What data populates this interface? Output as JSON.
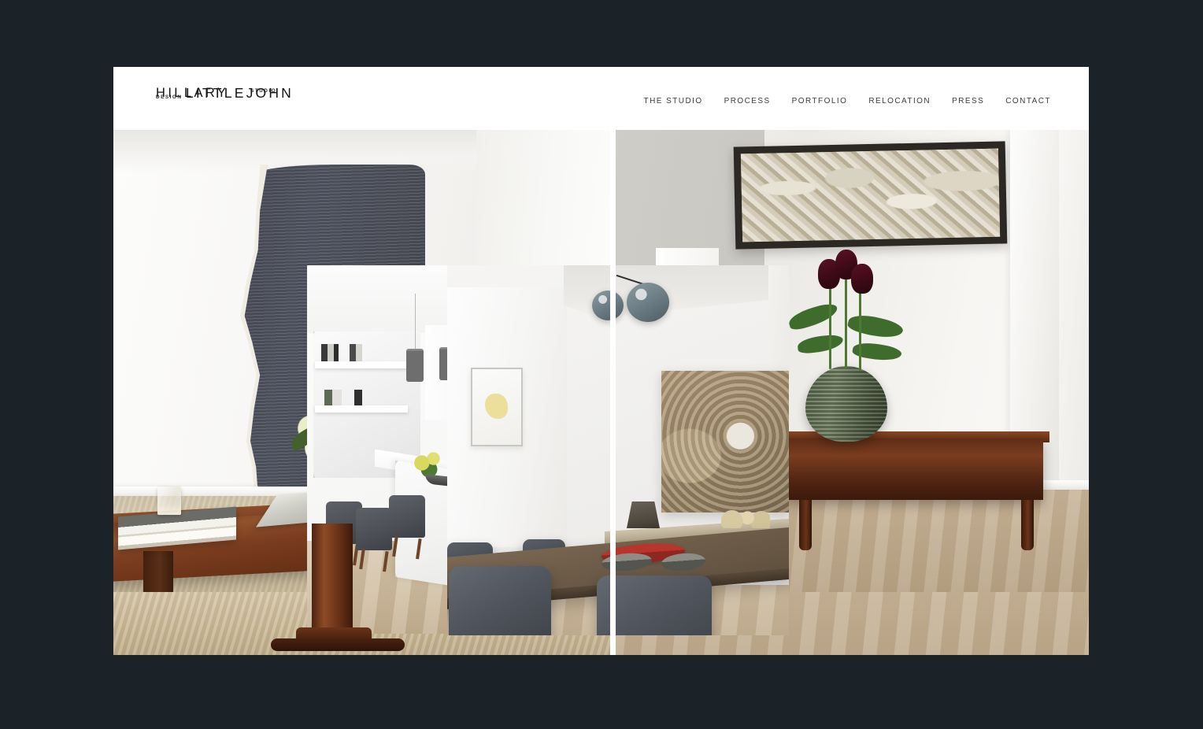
{
  "page": {
    "background_color": "#1c2328",
    "frame_background": "#ffffff"
  },
  "header": {
    "logo": {
      "line1_main": "HILLARY",
      "line1_sub": "STUDIO",
      "line2_main": "LITTLEJOHN",
      "line2_sub": "DESIGN",
      "color": "#141414"
    },
    "nav": {
      "items": [
        {
          "label": "THE STUDIO"
        },
        {
          "label": "PROCESS"
        },
        {
          "label": "PORTFOLIO"
        },
        {
          "label": "RELOCATION"
        },
        {
          "label": "PRESS"
        },
        {
          "label": "CONTACT"
        }
      ],
      "text_color": "#3c3c3c"
    }
  },
  "hero": {
    "type": "image-collage",
    "tiles": [
      {
        "name": "living-room",
        "alt": "Living room with dark wavy wall panel, wood coffee table, white hydrangeas, candle and stacked books"
      },
      {
        "name": "hallway",
        "alt": "Hallway with large abstract framed artwork, antique console table and dark tulips in a green ribbed vase"
      },
      {
        "name": "kitchen",
        "alt": "White marble kitchen with waterfall island, pendant lights, open shelving and grey dining chairs"
      },
      {
        "name": "dining-room",
        "alt": "Dining room with walnut table, grey upholstered chairs, glass pendant globes and a ceiling-dome photograph"
      }
    ]
  }
}
